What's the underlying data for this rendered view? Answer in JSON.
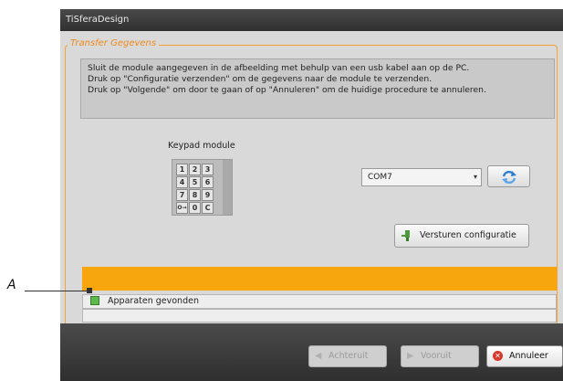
{
  "window": {
    "title": "TiSferaDesign"
  },
  "group": {
    "legend": "Transfer Gegevens"
  },
  "info": {
    "lines": [
      "Sluit de module aangegeven in de afbeelding met behulp van een usb kabel aan op de PC.",
      "Druk op \"Configuratie verzenden\" om de gegevens naar de module te verzenden.",
      "Druk op \"Volgende\" om door te gaan of op \"Annuleren\" om de huidige procedure te annuleren."
    ]
  },
  "keypad": {
    "title": "Keypad module",
    "keys": [
      "1",
      "2",
      "3",
      "4",
      "5",
      "6",
      "7",
      "8",
      "9",
      "O→",
      "0",
      "C"
    ]
  },
  "port": {
    "selected": "COM7",
    "arrow": "▾"
  },
  "buttons": {
    "refresh_icon": "refresh-icon",
    "send_label": "Versturen configuratie",
    "back_label": "Achteruit",
    "next_label": "Vooruit",
    "cancel_label": "Annuleer"
  },
  "progress": {
    "value": 1.0,
    "color": "#f7a70d"
  },
  "status": {
    "label": "Apparaten gevonden",
    "led_color": "#5fb84a"
  },
  "callout": {
    "label": "A"
  },
  "colors": {
    "accent": "#f08a1c"
  }
}
